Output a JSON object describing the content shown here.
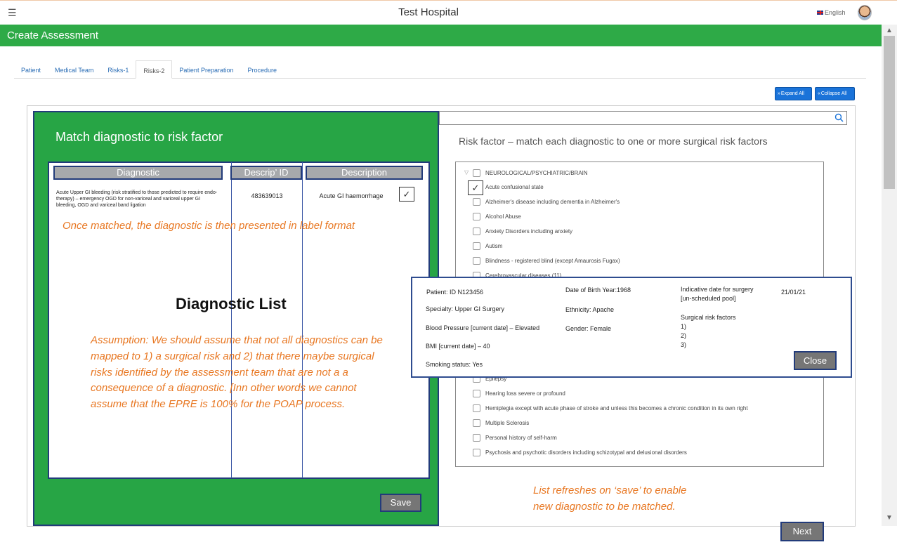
{
  "header": {
    "menu_icon": "hamburger-icon",
    "hospital_name": "Test Hospital",
    "language": "English"
  },
  "page": {
    "title": "Create Assessment"
  },
  "tabs": [
    {
      "label": "Patient"
    },
    {
      "label": "Medical Team"
    },
    {
      "label": "Risks-1"
    },
    {
      "label": "Risks-2",
      "active": true
    },
    {
      "label": "Patient Preparation"
    },
    {
      "label": "Procedure"
    }
  ],
  "toolbar": {
    "expand_all": "Expand All",
    "collapse_all": "Collapse All"
  },
  "match_panel": {
    "title": "Match diagnostic to risk factor",
    "columns": {
      "diagnostic": "Diagnostic",
      "descrip_id": "Descrip’ ID",
      "description": "Description"
    },
    "row": {
      "diagnostic": "Acute Upper GI bleeding (risk stratified to those predicted to require endo-therapy) – emergency OGD for non-variceal and variceal upper GI bleeding, OGD and variceal band ligation",
      "descrip_id": "483639013",
      "description": "Acute GI haemorrhage",
      "checked": true
    },
    "annotation_matched": "Once matched, the diagnostic is then presented in label format",
    "list_label": "Diagnostic List",
    "annotation_assumption": "Assumption: We should assume that not all diagnostics can be mapped to 1) a surgical risk and 2) that there maybe surgical risks identified by the assessment team that are not a a consequence of a diagnostic. [Inn other words we cannot assume that the EPRE is 100% for the POAP process.",
    "save_label": "Save"
  },
  "risk_panel": {
    "title": "Risk factor – match each diagnostic to one or more surgical risk factors",
    "group": "NEUROLOGICAL/PSYCHIATRIC/BRAIN",
    "items_top": [
      "Acute confusional state",
      "Alzheimer's disease including dementia in Alzheimer's",
      "Alcohol Abuse",
      "Anxiety Disorders including anxiety",
      "Autism",
      "Blindness - registered blind (except Amaurosis Fugax)",
      "Cerebrovascular diseases (11)"
    ],
    "items_bottom": [
      "Epilepsy",
      "Hearing loss severe or profound",
      "Hemiplegia except with acute phase of stroke and unless this becomes a chronic condition in its own right",
      "Multiple Sclerosis",
      "Personal history of self-harm",
      "Psychosis and psychotic disorders including schizotypal and delusional disorders"
    ],
    "annotation_refresh": "List refreshes on ‘save’ to enable new diagnostic to be matched."
  },
  "patient_popup": {
    "patient": "Patient: ID N123456",
    "specialty": "Specialty: Upper GI Surgery",
    "blood_pressure": "Blood Pressure [current date] – Elevated",
    "bmi": "BMI [current date] – 40",
    "smoking": "Smoking status: Yes",
    "dob": "Date of Birth Year:1968",
    "ethnicity": "Ethnicity: Apache",
    "gender": "Gender: Female",
    "indicative_label": "Indicative date for surgery",
    "indicative_pool": "[un-scheduled pool]",
    "indicative_date": "21/01/21",
    "risk_factors_label": "Surgical risk factors",
    "risk_factor_slots": [
      "1)",
      "2)",
      "3)"
    ],
    "close_label": "Close"
  },
  "footer": {
    "next_label": "Next"
  }
}
